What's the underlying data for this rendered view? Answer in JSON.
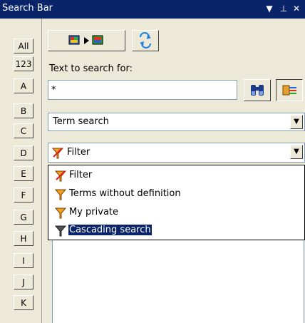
{
  "window": {
    "title": "Search Bar"
  },
  "letters": [
    "All",
    "123",
    "A",
    "B",
    "C",
    "D",
    "E",
    "F",
    "G",
    "H",
    "I",
    "J",
    "K"
  ],
  "search": {
    "label": "Text to search for:",
    "value": "*"
  },
  "search_type": {
    "selected": "Term search"
  },
  "filter": {
    "selected": "Filter",
    "options": [
      {
        "label": "Filter",
        "icon": "filter-funnel-icon"
      },
      {
        "label": "Terms without definition",
        "icon": "funnel-orange-icon"
      },
      {
        "label": "My private",
        "icon": "funnel-orange-icon"
      },
      {
        "label": "Cascading search",
        "icon": "funnel-gray-icon"
      }
    ],
    "highlighted_option": "Cascading search"
  },
  "colors": {
    "titlebar": "#0a246a",
    "panel": "#ece9d8",
    "selection": "#0a246a"
  }
}
